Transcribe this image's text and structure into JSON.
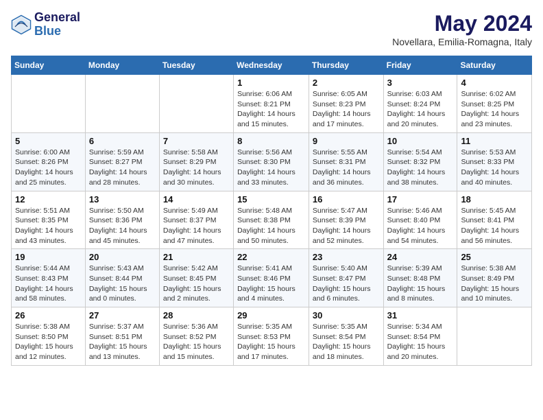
{
  "header": {
    "logo_line1": "General",
    "logo_line2": "Blue",
    "month_title": "May 2024",
    "location": "Novellara, Emilia-Romagna, Italy"
  },
  "days_of_week": [
    "Sunday",
    "Monday",
    "Tuesday",
    "Wednesday",
    "Thursday",
    "Friday",
    "Saturday"
  ],
  "weeks": [
    [
      {
        "day": "",
        "info": ""
      },
      {
        "day": "",
        "info": ""
      },
      {
        "day": "",
        "info": ""
      },
      {
        "day": "1",
        "info": "Sunrise: 6:06 AM\nSunset: 8:21 PM\nDaylight: 14 hours\nand 15 minutes."
      },
      {
        "day": "2",
        "info": "Sunrise: 6:05 AM\nSunset: 8:23 PM\nDaylight: 14 hours\nand 17 minutes."
      },
      {
        "day": "3",
        "info": "Sunrise: 6:03 AM\nSunset: 8:24 PM\nDaylight: 14 hours\nand 20 minutes."
      },
      {
        "day": "4",
        "info": "Sunrise: 6:02 AM\nSunset: 8:25 PM\nDaylight: 14 hours\nand 23 minutes."
      }
    ],
    [
      {
        "day": "5",
        "info": "Sunrise: 6:00 AM\nSunset: 8:26 PM\nDaylight: 14 hours\nand 25 minutes."
      },
      {
        "day": "6",
        "info": "Sunrise: 5:59 AM\nSunset: 8:27 PM\nDaylight: 14 hours\nand 28 minutes."
      },
      {
        "day": "7",
        "info": "Sunrise: 5:58 AM\nSunset: 8:29 PM\nDaylight: 14 hours\nand 30 minutes."
      },
      {
        "day": "8",
        "info": "Sunrise: 5:56 AM\nSunset: 8:30 PM\nDaylight: 14 hours\nand 33 minutes."
      },
      {
        "day": "9",
        "info": "Sunrise: 5:55 AM\nSunset: 8:31 PM\nDaylight: 14 hours\nand 36 minutes."
      },
      {
        "day": "10",
        "info": "Sunrise: 5:54 AM\nSunset: 8:32 PM\nDaylight: 14 hours\nand 38 minutes."
      },
      {
        "day": "11",
        "info": "Sunrise: 5:53 AM\nSunset: 8:33 PM\nDaylight: 14 hours\nand 40 minutes."
      }
    ],
    [
      {
        "day": "12",
        "info": "Sunrise: 5:51 AM\nSunset: 8:35 PM\nDaylight: 14 hours\nand 43 minutes."
      },
      {
        "day": "13",
        "info": "Sunrise: 5:50 AM\nSunset: 8:36 PM\nDaylight: 14 hours\nand 45 minutes."
      },
      {
        "day": "14",
        "info": "Sunrise: 5:49 AM\nSunset: 8:37 PM\nDaylight: 14 hours\nand 47 minutes."
      },
      {
        "day": "15",
        "info": "Sunrise: 5:48 AM\nSunset: 8:38 PM\nDaylight: 14 hours\nand 50 minutes."
      },
      {
        "day": "16",
        "info": "Sunrise: 5:47 AM\nSunset: 8:39 PM\nDaylight: 14 hours\nand 52 minutes."
      },
      {
        "day": "17",
        "info": "Sunrise: 5:46 AM\nSunset: 8:40 PM\nDaylight: 14 hours\nand 54 minutes."
      },
      {
        "day": "18",
        "info": "Sunrise: 5:45 AM\nSunset: 8:41 PM\nDaylight: 14 hours\nand 56 minutes."
      }
    ],
    [
      {
        "day": "19",
        "info": "Sunrise: 5:44 AM\nSunset: 8:43 PM\nDaylight: 14 hours\nand 58 minutes."
      },
      {
        "day": "20",
        "info": "Sunrise: 5:43 AM\nSunset: 8:44 PM\nDaylight: 15 hours\nand 0 minutes."
      },
      {
        "day": "21",
        "info": "Sunrise: 5:42 AM\nSunset: 8:45 PM\nDaylight: 15 hours\nand 2 minutes."
      },
      {
        "day": "22",
        "info": "Sunrise: 5:41 AM\nSunset: 8:46 PM\nDaylight: 15 hours\nand 4 minutes."
      },
      {
        "day": "23",
        "info": "Sunrise: 5:40 AM\nSunset: 8:47 PM\nDaylight: 15 hours\nand 6 minutes."
      },
      {
        "day": "24",
        "info": "Sunrise: 5:39 AM\nSunset: 8:48 PM\nDaylight: 15 hours\nand 8 minutes."
      },
      {
        "day": "25",
        "info": "Sunrise: 5:38 AM\nSunset: 8:49 PM\nDaylight: 15 hours\nand 10 minutes."
      }
    ],
    [
      {
        "day": "26",
        "info": "Sunrise: 5:38 AM\nSunset: 8:50 PM\nDaylight: 15 hours\nand 12 minutes."
      },
      {
        "day": "27",
        "info": "Sunrise: 5:37 AM\nSunset: 8:51 PM\nDaylight: 15 hours\nand 13 minutes."
      },
      {
        "day": "28",
        "info": "Sunrise: 5:36 AM\nSunset: 8:52 PM\nDaylight: 15 hours\nand 15 minutes."
      },
      {
        "day": "29",
        "info": "Sunrise: 5:35 AM\nSunset: 8:53 PM\nDaylight: 15 hours\nand 17 minutes."
      },
      {
        "day": "30",
        "info": "Sunrise: 5:35 AM\nSunset: 8:54 PM\nDaylight: 15 hours\nand 18 minutes."
      },
      {
        "day": "31",
        "info": "Sunrise: 5:34 AM\nSunset: 8:54 PM\nDaylight: 15 hours\nand 20 minutes."
      },
      {
        "day": "",
        "info": ""
      }
    ]
  ]
}
